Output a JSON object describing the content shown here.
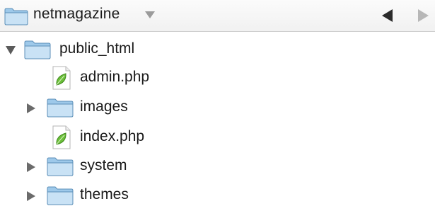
{
  "pathbar": {
    "folder_name": "netmagazine",
    "icons": {
      "folder": "folder-icon",
      "dropdown": "dropdown-arrow-icon",
      "back": "back-arrow-icon",
      "forward": "forward-arrow-icon"
    }
  },
  "tree": {
    "items": [
      {
        "label": "public_html",
        "type": "folder",
        "expanded": true,
        "icon": "folder-icon"
      },
      {
        "label": "admin.php",
        "type": "file",
        "icon": "php-file-leaf-icon"
      },
      {
        "label": "images",
        "type": "folder",
        "expanded": false,
        "icon": "folder-icon"
      },
      {
        "label": "index.php",
        "type": "file",
        "icon": "php-file-leaf-icon"
      },
      {
        "label": "system",
        "type": "folder",
        "expanded": false,
        "icon": "folder-icon"
      },
      {
        "label": "themes",
        "type": "folder",
        "expanded": false,
        "icon": "folder-icon"
      }
    ]
  },
  "colors": {
    "folder_blue": "#8fc0e3",
    "leaf_green": "#6cbf3a",
    "text": "#1a1a1a"
  }
}
